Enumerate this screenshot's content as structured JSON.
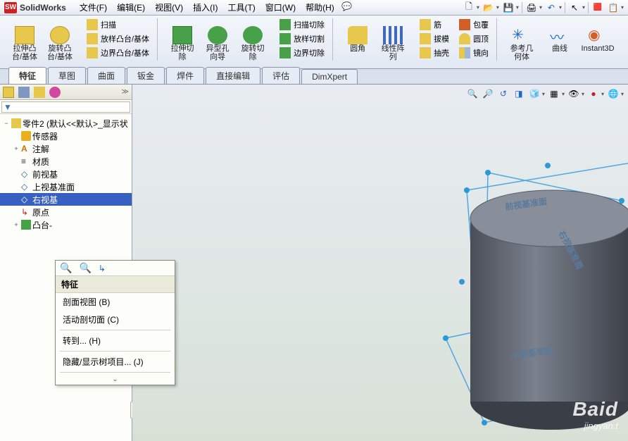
{
  "app": {
    "name": "SolidWorks"
  },
  "menus": [
    "文件(F)",
    "编辑(E)",
    "视图(V)",
    "插入(I)",
    "工具(T)",
    "窗口(W)",
    "帮助(H)"
  ],
  "ribbon": {
    "g1": {
      "btn1": "拉伸凸\n台/基体",
      "btn2": "旋转凸\n台/基体"
    },
    "g1s": [
      "扫描",
      "放样凸台/基体",
      "边界凸台/基体"
    ],
    "g2": {
      "b1": "拉伸切\n除",
      "b2": "异型孔\n向导",
      "b3": "旋转切\n除"
    },
    "g2s": [
      "扫描切除",
      "放样切割",
      "边界切除"
    ],
    "g3": {
      "b1": "圆角",
      "b2": "线性阵\n列"
    },
    "g3s": [
      "筋",
      "拔模",
      "抽壳"
    ],
    "g3s2": [
      "包覆",
      "圆顶",
      "镜向"
    ],
    "g4": {
      "b1": "参考几\n何体",
      "b2": "曲线",
      "b3": "Instant3D"
    }
  },
  "tabs": [
    "特征",
    "草图",
    "曲面",
    "钣金",
    "焊件",
    "直接编辑",
    "评估",
    "DimXpert"
  ],
  "active_tab": 0,
  "tree": {
    "root": "零件2 (默认<<默认>_显示状",
    "items": [
      "传感器",
      "注解",
      "材质",
      "前视基",
      "上视基准面",
      "右视基",
      "原点",
      "凸台-"
    ]
  },
  "filter_placeholder": "",
  "ctx": {
    "header": "特征",
    "items": [
      "剖面视图 (B)",
      "活动剖切面 (C)",
      "转到... (H)",
      "隐藏/显示树项目... (J)"
    ]
  },
  "plane_labels": {
    "front": "前视基准面",
    "top": "上视基准面",
    "right": "右视基准面"
  },
  "watermark": {
    "big": "Baid",
    "small": "jingyan.t"
  }
}
